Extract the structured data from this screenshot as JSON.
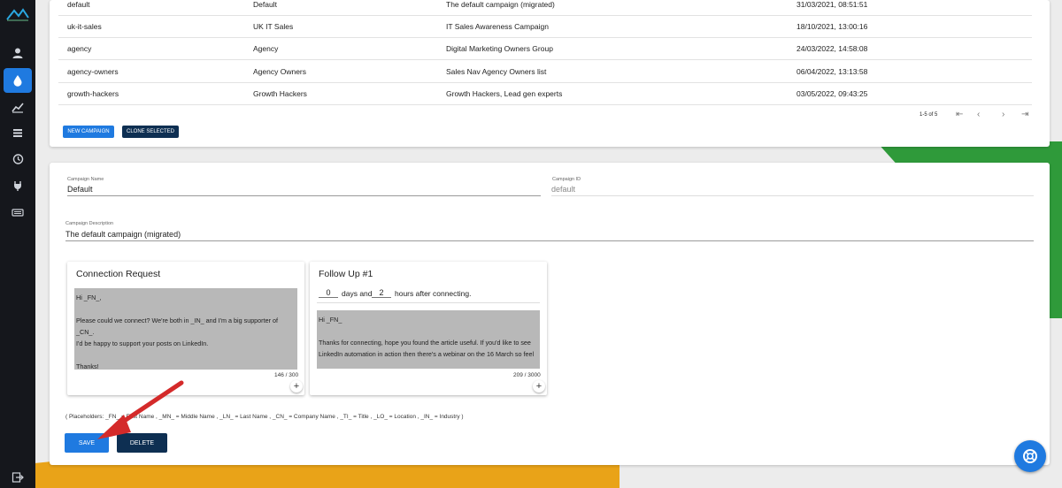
{
  "campaigns": {
    "rows": [
      {
        "id": "default",
        "name": "Default",
        "description": "The default campaign (migrated)",
        "date": "31/03/2021, 08:51:51"
      },
      {
        "id": "uk-it-sales",
        "name": "UK IT Sales",
        "description": "IT Sales Awareness Campaign",
        "date": "18/10/2021, 13:00:16"
      },
      {
        "id": "agency",
        "name": "Agency",
        "description": "Digital Marketing Owners Group",
        "date": "24/03/2022, 14:58:08"
      },
      {
        "id": "agency-owners",
        "name": "Agency Owners",
        "description": "Sales Nav Agency Owners list",
        "date": "06/04/2022, 13:13:58"
      },
      {
        "id": "growth-hackers",
        "name": "Growth Hackers",
        "description": "Growth Hackers, Lead gen experts",
        "date": "03/05/2022, 09:43:25"
      }
    ],
    "pager": "1-5 of 5",
    "new_label": "NEW CAMPAIGN",
    "clone_label": "CLONE SELECTED"
  },
  "editor": {
    "name_label": "Campaign Name",
    "name_value": "Default",
    "id_label": "Campaign ID",
    "id_value": "default",
    "desc_label": "Campaign Description",
    "desc_value": "The default campaign (migrated)",
    "connection": {
      "title": "Connection Request",
      "lines": [
        "Hi _FN_,",
        "",
        "Please could we connect? We're both in _IN_ and I'm a big supporter of _CN_.",
        "I'd be happy to support your posts on LinkedIn.",
        "",
        "Thanks!"
      ],
      "count": "146 / 300"
    },
    "followup": {
      "title": "Follow Up #1",
      "days": "0",
      "days_text": "days and",
      "hours": "2",
      "hours_text": "hours after connecting.",
      "lines": [
        "Hi _FN_",
        "",
        "Thanks for connecting, hope you found the article useful. If you'd like to see",
        "LinkedIn automation in action then there's a webinar on the 16 March so feel"
      ],
      "count": "209 / 3000"
    },
    "placeholders": "( Placeholders: _FN_ = First Name , _MN_ = Middle Name , _LN_ = Last Name , _CN_ = Company Name , _TI_ = Title , _LO_ = Location , _IN_ = Industry )",
    "save_label": "SAVE",
    "delete_label": "DELETE"
  },
  "colors": {
    "accent": "#1f7ae0",
    "navy": "#0e2f52",
    "sidebar": "#15171c"
  }
}
